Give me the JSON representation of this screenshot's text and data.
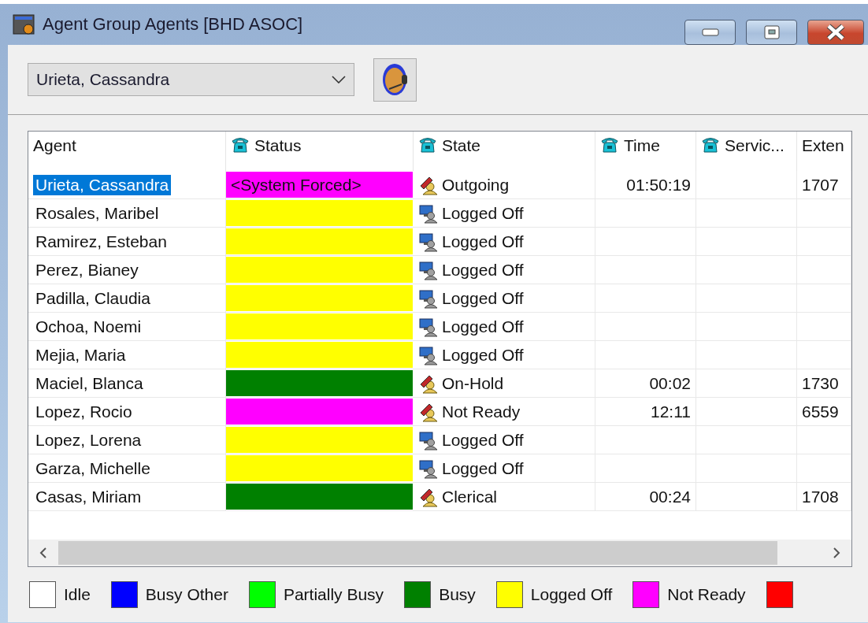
{
  "window": {
    "title": "Agent Group Agents [BHD ASOC]"
  },
  "toolbar": {
    "agent_select": {
      "value": "Urieta, Cassandra"
    }
  },
  "table": {
    "columns": [
      {
        "label": "Agent",
        "icon": false
      },
      {
        "label": "Status",
        "icon": true
      },
      {
        "label": "State",
        "icon": true
      },
      {
        "label": "Time",
        "icon": true
      },
      {
        "label": "Servic...",
        "icon": true
      },
      {
        "label": "Exten",
        "icon": false
      }
    ],
    "rows": [
      {
        "agent": "Urieta, Cassandra",
        "selected": true,
        "status": "<System Forced>",
        "color": "#ff00ff",
        "state": "Outgoing",
        "kind": "handset",
        "time": "01:50:19",
        "extension": "1707"
      },
      {
        "agent": "Rosales, Maribel",
        "selected": false,
        "color": "#ffff00",
        "state": "Logged Off",
        "kind": "monitor"
      },
      {
        "agent": "Ramirez, Esteban",
        "selected": false,
        "color": "#ffff00",
        "state": "Logged Off",
        "kind": "monitor"
      },
      {
        "agent": "Perez, Bianey",
        "selected": false,
        "color": "#ffff00",
        "state": "Logged Off",
        "kind": "monitor"
      },
      {
        "agent": "Padilla, Claudia",
        "selected": false,
        "color": "#ffff00",
        "state": "Logged Off",
        "kind": "monitor"
      },
      {
        "agent": "Ochoa, Noemi",
        "selected": false,
        "color": "#ffff00",
        "state": "Logged Off",
        "kind": "monitor"
      },
      {
        "agent": "Mejia, Maria",
        "selected": false,
        "color": "#ffff00",
        "state": "Logged Off",
        "kind": "monitor"
      },
      {
        "agent": "Maciel, Blanca",
        "selected": false,
        "color": "#008000",
        "state": "On-Hold",
        "kind": "handset",
        "time": "00:02",
        "extension": "1730"
      },
      {
        "agent": "Lopez, Rocio",
        "selected": false,
        "color": "#ff00ff",
        "state": "Not Ready",
        "kind": "handset",
        "time": "12:11",
        "extension": "6559"
      },
      {
        "agent": "Lopez, Lorena",
        "selected": false,
        "color": "#ffff00",
        "state": "Logged Off",
        "kind": "monitor"
      },
      {
        "agent": "Garza, Michelle",
        "selected": false,
        "color": "#ffff00",
        "state": "Logged Off",
        "kind": "monitor"
      },
      {
        "agent": "Casas, Miriam",
        "selected": false,
        "color": "#008000",
        "state": "Clerical",
        "kind": "handset",
        "time": "00:24",
        "extension": "1708"
      }
    ]
  },
  "legend": [
    {
      "label": "Idle",
      "color": "#ffffff"
    },
    {
      "label": "Busy Other",
      "color": "#0000ff"
    },
    {
      "label": "Partially Busy",
      "color": "#00ff00"
    },
    {
      "label": "Busy",
      "color": "#008000"
    },
    {
      "label": "Logged Off",
      "color": "#ffff00"
    },
    {
      "label": "Not Ready",
      "color": "#ff00ff"
    },
    {
      "color": "#ff0000"
    }
  ]
}
